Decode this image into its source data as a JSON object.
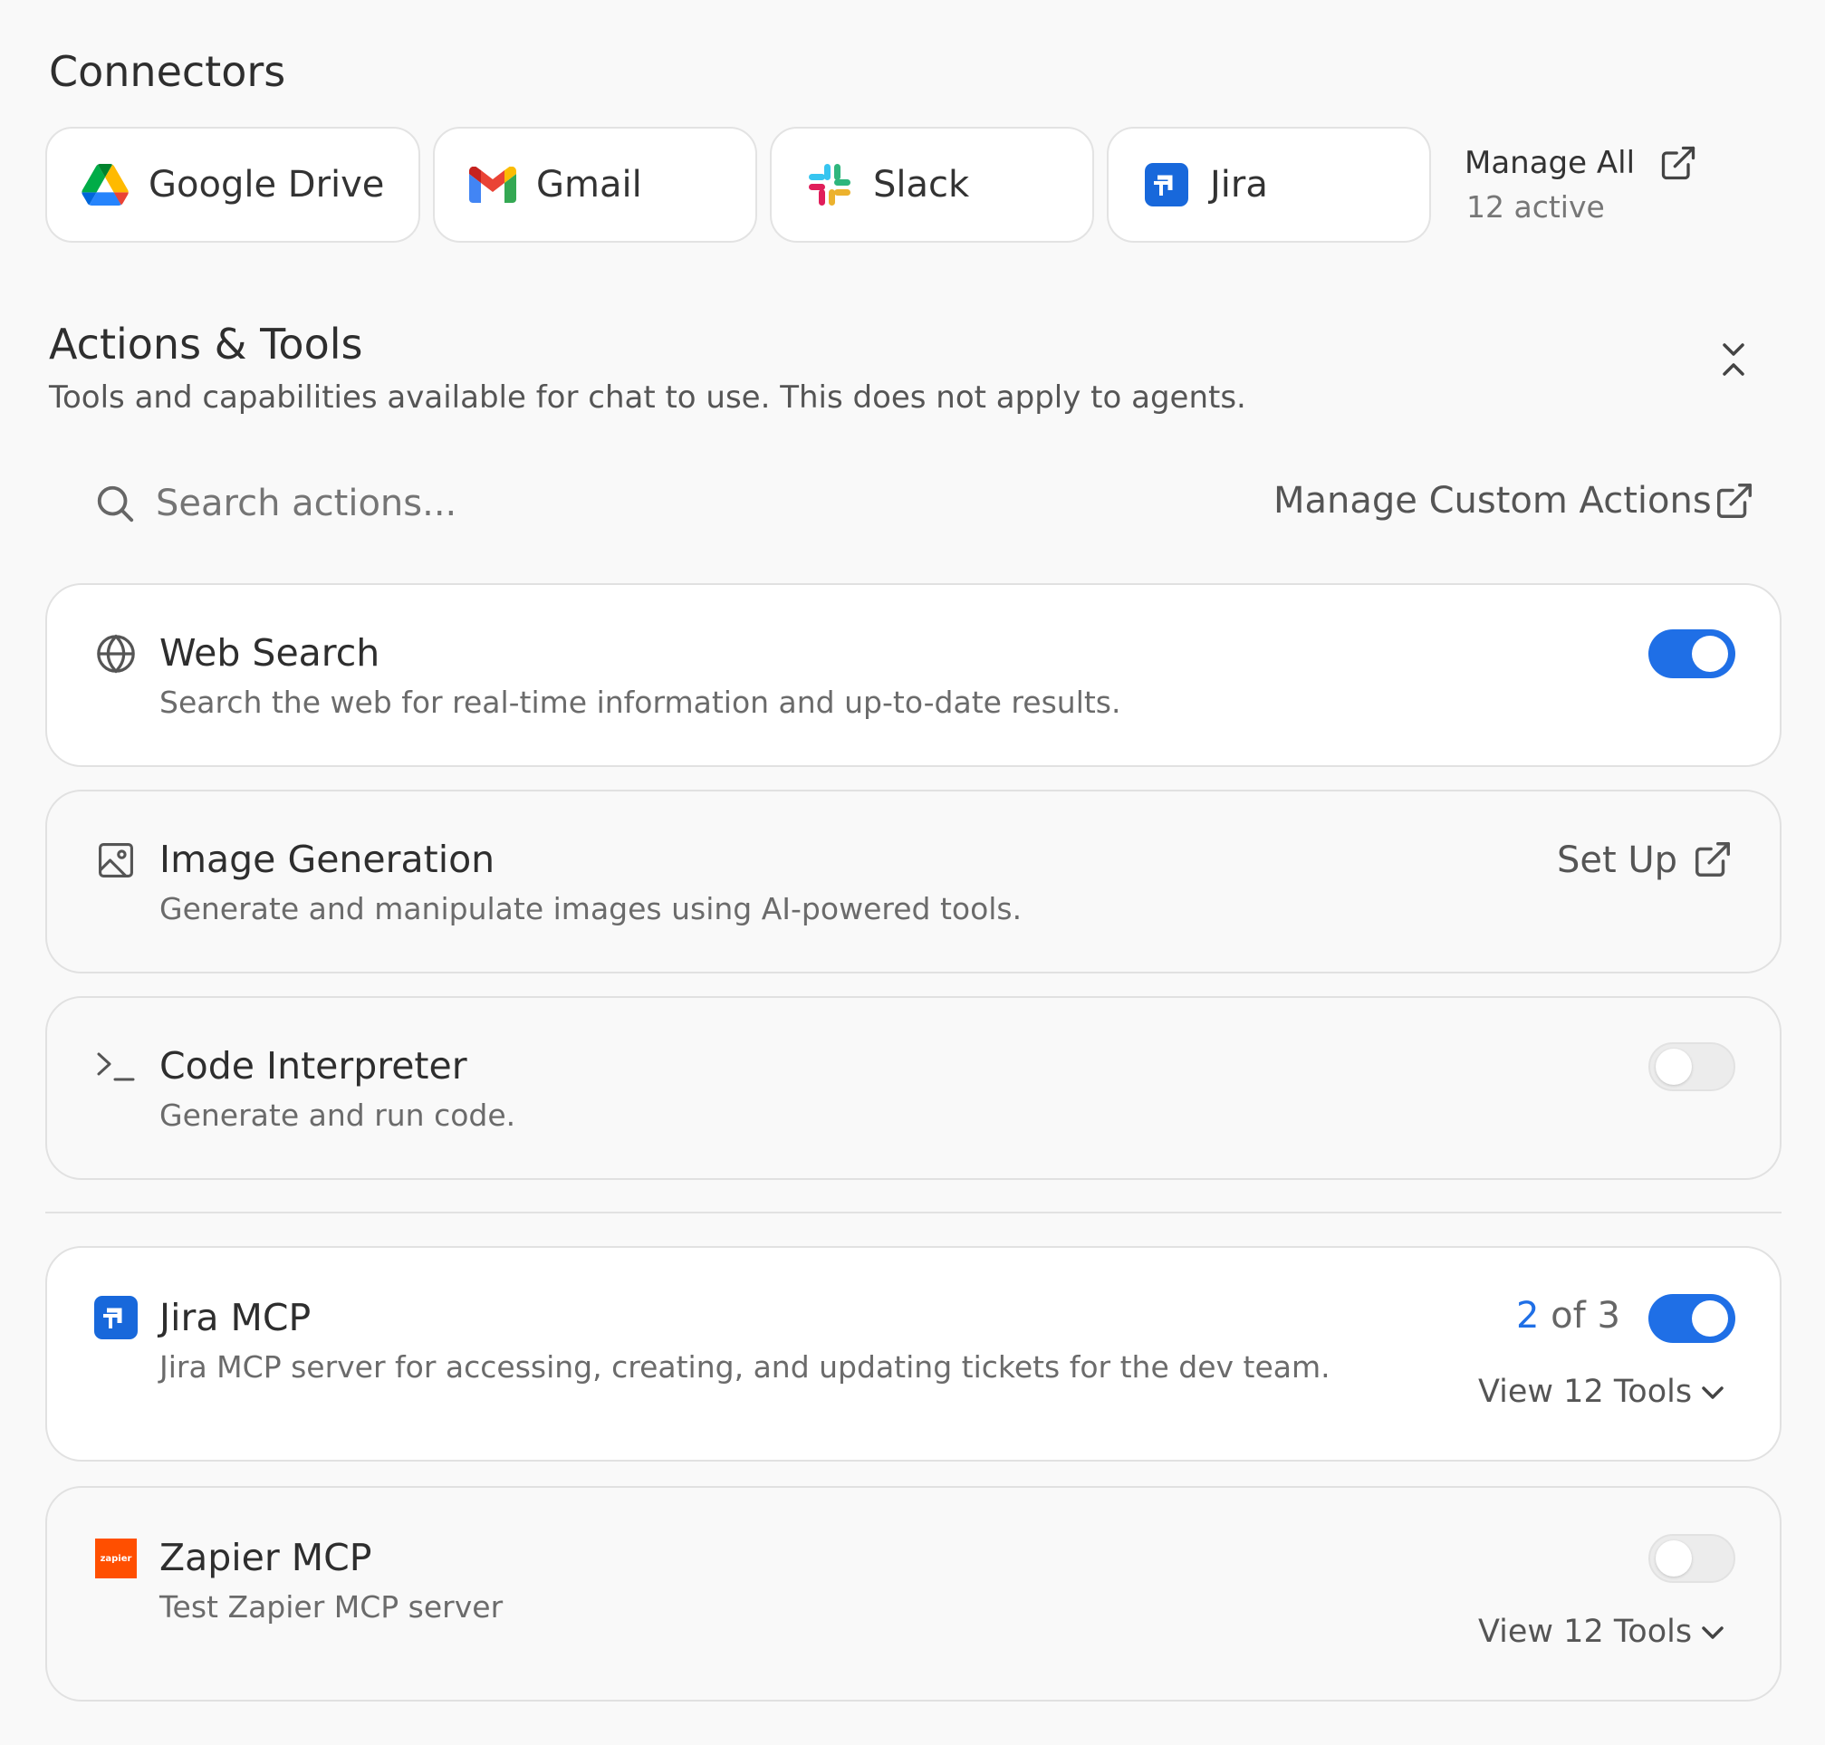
{
  "connectors": {
    "title": "Connectors",
    "items": [
      {
        "label": "Google Drive",
        "icon": "google-drive-icon"
      },
      {
        "label": "Gmail",
        "icon": "gmail-icon"
      },
      {
        "label": "Slack",
        "icon": "slack-icon"
      },
      {
        "label": "Jira",
        "icon": "jira-icon"
      }
    ],
    "manage_all": {
      "label": "Manage All",
      "sub": "12 active",
      "icon": "external-link-icon"
    }
  },
  "actions": {
    "title": "Actions & Tools",
    "subtitle": "Tools and capabilities available for chat to use. This does not apply to agents.",
    "collapse_icon": "collapse-icon",
    "search": {
      "placeholder": "Search actions...",
      "icon": "search-icon"
    },
    "manage_custom": {
      "label": "Manage Custom Actions",
      "icon": "external-link-icon"
    },
    "tools": [
      {
        "title": "Web Search",
        "desc": "Search the web for real-time information and up-to-date results.",
        "icon": "globe-icon",
        "enabled": true
      },
      {
        "title": "Image Generation",
        "desc": "Generate and manipulate images using AI-powered tools.",
        "icon": "image-icon",
        "setup_label": "Set Up"
      },
      {
        "title": "Code Interpreter",
        "desc": "Generate and run code.",
        "icon": "terminal-icon",
        "enabled": false
      }
    ],
    "mcp": [
      {
        "title": "Jira MCP",
        "desc": "Jira MCP server for accessing, creating, and updating tickets for the dev team.",
        "icon": "jira-icon",
        "enabled": true,
        "count_active": "2",
        "count_rest": "of 3",
        "view_tools": "View 12 Tools"
      },
      {
        "title": "Zapier MCP",
        "desc": "Test Zapier MCP server",
        "icon": "zapier-icon",
        "icon_text": "zapier",
        "enabled": false,
        "view_tools": "View 12 Tools"
      }
    ]
  },
  "colors": {
    "accent": "#1f6fe6",
    "zapier": "#ff4f00",
    "jira": "#1868db"
  }
}
